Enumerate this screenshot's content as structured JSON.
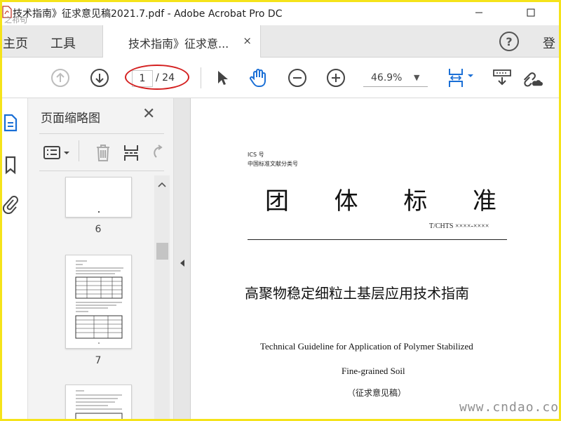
{
  "window": {
    "title": "技术指南》征求意见稿2021.7.pdf - Adobe Acrobat Pro DC",
    "title_overlay": "之祁句"
  },
  "tabs": {
    "home": "主页",
    "tools": "工具",
    "document": "技术指南》征求意...",
    "close_glyph": "×",
    "help": "?",
    "sign_in": "登"
  },
  "toolbar": {
    "current_page": "1",
    "total_pages": "/ 24",
    "zoom": "46.9%",
    "zoom_caret": "▼",
    "annotation_color": "#d42020"
  },
  "thumbnails_panel": {
    "title": "页面缩略图",
    "close_glyph": "✕",
    "pages": [
      {
        "number": "6"
      },
      {
        "number": "7"
      }
    ]
  },
  "document": {
    "ics_line1": "ICS 号",
    "ics_line2": "中国标准文献分类号",
    "big_title": [
      "团",
      "体",
      "标",
      "准"
    ],
    "standard_code": "T/CHTS ××××-××××",
    "cn_title": "高聚物稳定细粒土基层应用技术指南",
    "en_title_line1": "Technical Guideline for Application of Polymer Stabilized",
    "en_title_line2": "Fine-grained Soil",
    "draft_label": "（征求意见稿）"
  },
  "watermark": "www.cndao.com",
  "colors": {
    "frame_border": "#f5e31a",
    "active_icon_blue": "#1a6fd6",
    "icon_gray": "#555555"
  }
}
